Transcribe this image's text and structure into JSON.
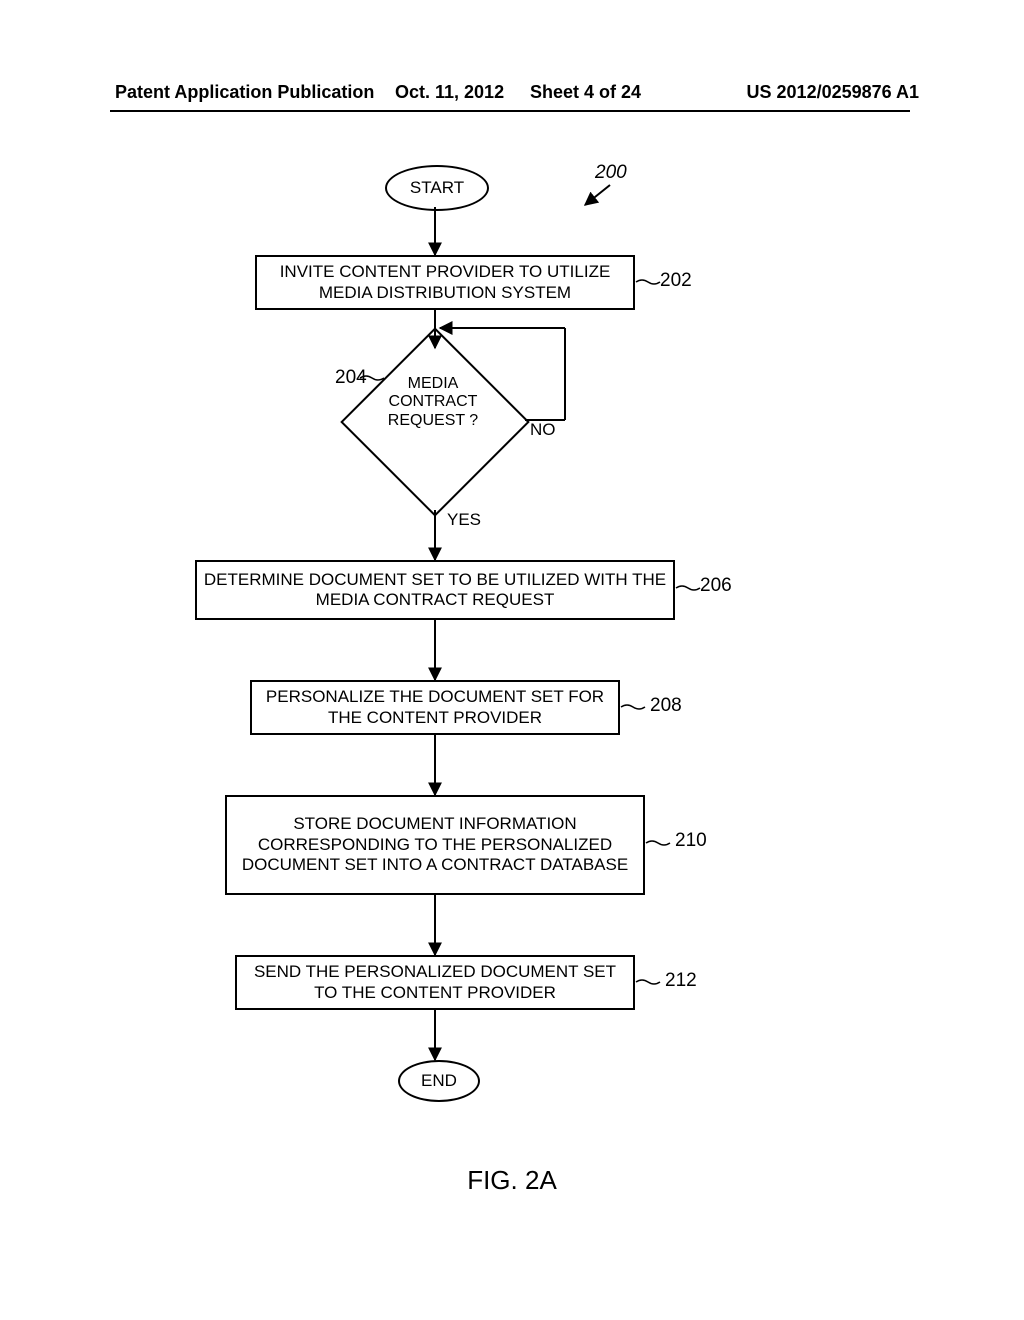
{
  "header": {
    "left": "Patent Application Publication",
    "date": "Oct. 11, 2012",
    "sheet": "Sheet 4 of 24",
    "right": "US 2012/0259876 A1"
  },
  "terminators": {
    "start": "START",
    "end": "END"
  },
  "steps": {
    "invite": "INVITE CONTENT PROVIDER TO UTILIZE MEDIA DISTRIBUTION SYSTEM",
    "decision": "MEDIA CONTRACT REQUEST ?",
    "determine": "DETERMINE DOCUMENT SET TO BE UTILIZED WITH THE MEDIA CONTRACT REQUEST",
    "personalize": "PERSONALIZE THE DOCUMENT SET FOR THE CONTENT PROVIDER",
    "store": "STORE DOCUMENT INFORMATION CORRESPONDING TO THE PERSONALIZED DOCUMENT SET INTO A CONTRACT DATABASE",
    "send": "SEND THE PERSONALIZED DOCUMENT SET TO THE CONTENT PROVIDER"
  },
  "edge_labels": {
    "yes": "YES",
    "no": "NO"
  },
  "refs": {
    "r200": "200",
    "r202": "202",
    "r204": "204",
    "r206": "206",
    "r208": "208",
    "r210": "210",
    "r212": "212"
  },
  "figure": "FIG. 2A"
}
